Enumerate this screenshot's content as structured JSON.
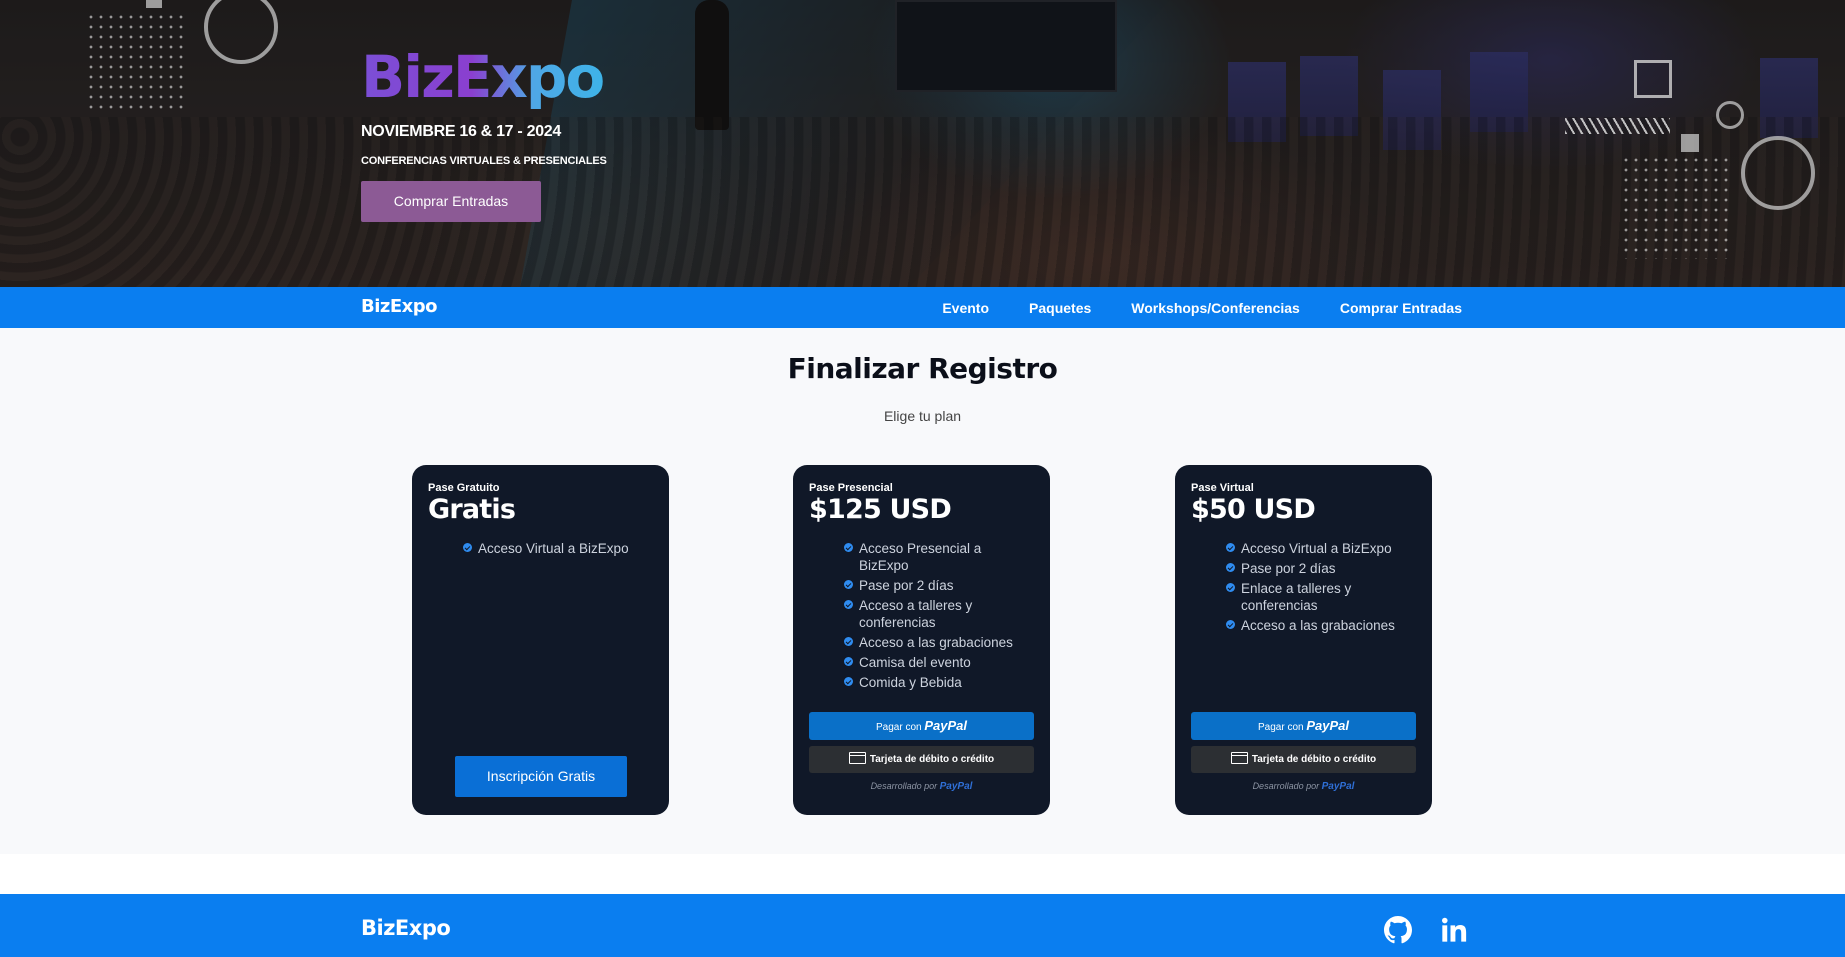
{
  "hero": {
    "logo": "BizExpo",
    "date": "NOVIEMBRE 16 & 17 - 2024",
    "subtitle": "CONFERENCIAS VIRTUALES & PRESENCIALES",
    "cta_label": "Comprar Entradas"
  },
  "nav": {
    "brand": "BizExpo",
    "links": [
      "Evento",
      "Paquetes",
      "Workshops/Conferencias",
      "Comprar Entradas"
    ]
  },
  "main": {
    "title": "Finalizar Registro",
    "subtitle": "Elige tu plan"
  },
  "plans": [
    {
      "kind": "Pase Gratuito",
      "price": "Gratis",
      "features": [
        "Acceso Virtual a BizExpo"
      ],
      "button_label": "Inscripción Gratis"
    },
    {
      "kind": "Pase Presencial",
      "price": "$125 USD",
      "features": [
        "Acceso Presencial a BizExpo",
        "Pase por 2 días",
        "Acceso a talleres y conferencias",
        "Acceso a las grabaciones",
        "Camisa del evento",
        "Comida y Bebida"
      ],
      "paypal_prefix": "Pagar con",
      "paypal_brand": "PayPal",
      "card_label": "Tarjeta de débito o crédito",
      "powered_prefix": "Desarrollado por",
      "powered_brand": "PayPal"
    },
    {
      "kind": "Pase Virtual",
      "price": "$50 USD",
      "features": [
        "Acceso Virtual a BizExpo",
        "Pase por 2 días",
        "Enlace a talleres y conferencias",
        "Acceso a las grabaciones"
      ],
      "paypal_prefix": "Pagar con",
      "paypal_brand": "PayPal",
      "card_label": "Tarjeta de débito o crédito",
      "powered_prefix": "Desarrollado por",
      "powered_brand": "PayPal"
    }
  ],
  "footer": {
    "brand": "BizExpo",
    "icons": [
      "github-icon",
      "linkedin-icon"
    ]
  },
  "colors": {
    "nav_blue": "#0a7ef0",
    "card_bg": "#101828",
    "cta_purple": "#8c5a95",
    "paypal_blue": "#0a70c8"
  }
}
